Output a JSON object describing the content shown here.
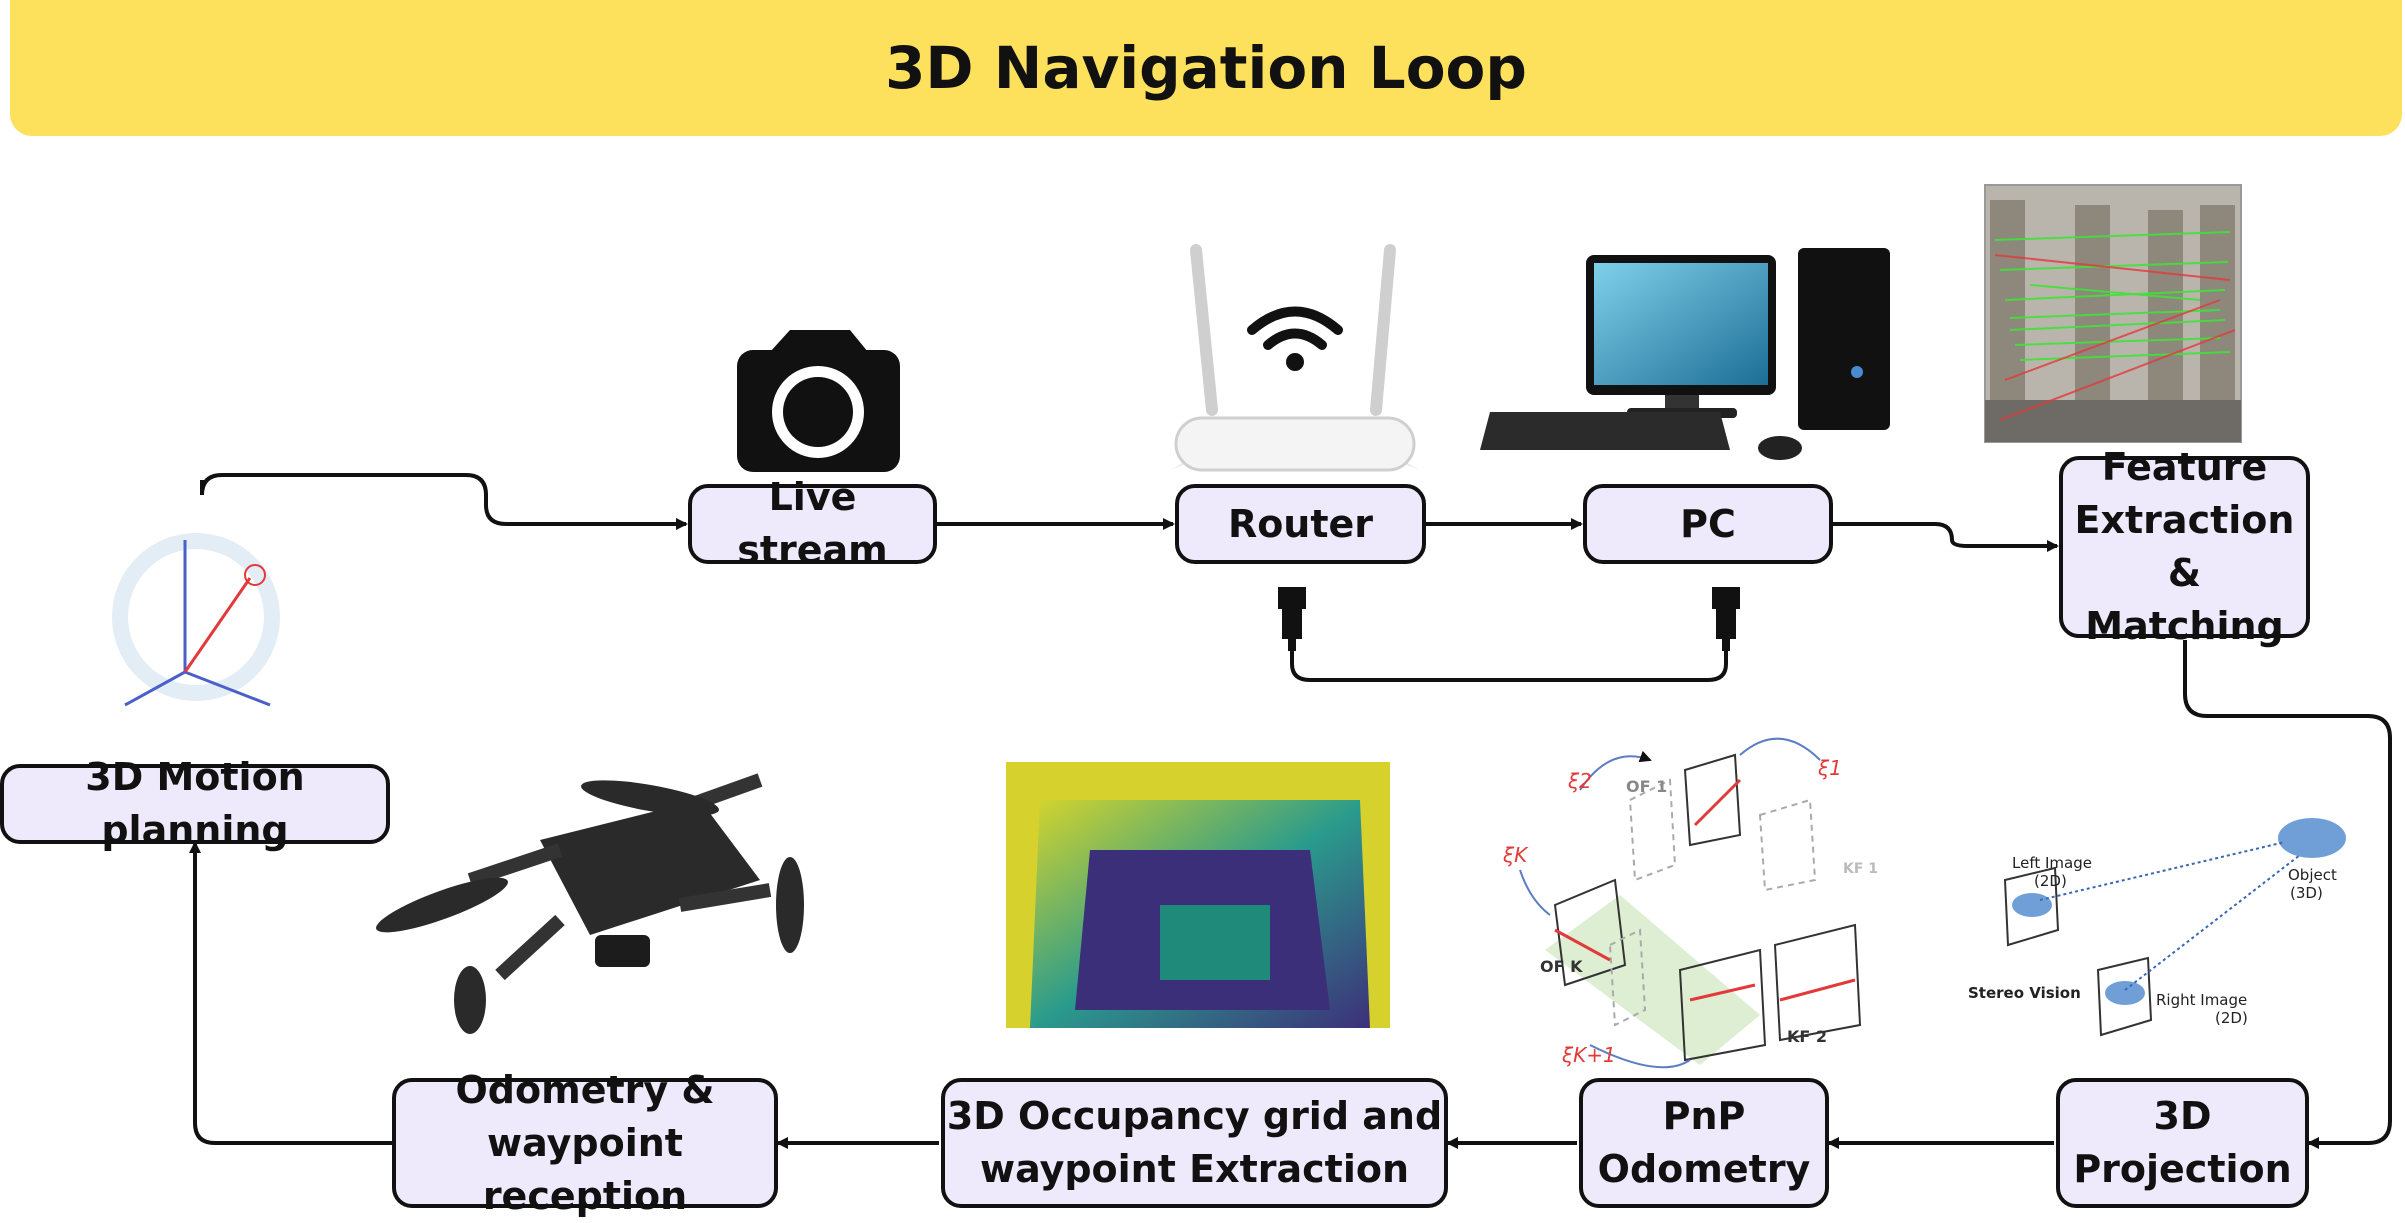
{
  "title": "3D Navigation Loop",
  "nodes": {
    "live_stream": "Live stream",
    "router": "Router",
    "pc": "PC",
    "feature": "Feature\nExtraction &\nMatching",
    "motion": "3D Motion planning",
    "odometry_reception": "Odometry &\nwaypoint reception",
    "occupancy": "3D Occupancy grid and\nwaypoint Extraction",
    "pnp": "PnP\nOdometry",
    "projection": "3D\nProjection"
  },
  "illustrations": {
    "slam": {
      "xi_2": "ξ2",
      "xi_1": "ξ1",
      "xi_k": "ξK",
      "xi_k1": "ξK+1",
      "of1": "OF 1",
      "ofk": "OF K",
      "kf1": "KF 1",
      "kf2": "KF 2"
    },
    "stereo": {
      "left": "Left Image\n(2D)",
      "right": "Right Image\n(2D)",
      "object": "Object\n(3D)",
      "caption": "Stereo Vision"
    }
  },
  "colors": {
    "banner": "#fde05c",
    "node_fill": "#eeeafc",
    "line": "#111111"
  }
}
